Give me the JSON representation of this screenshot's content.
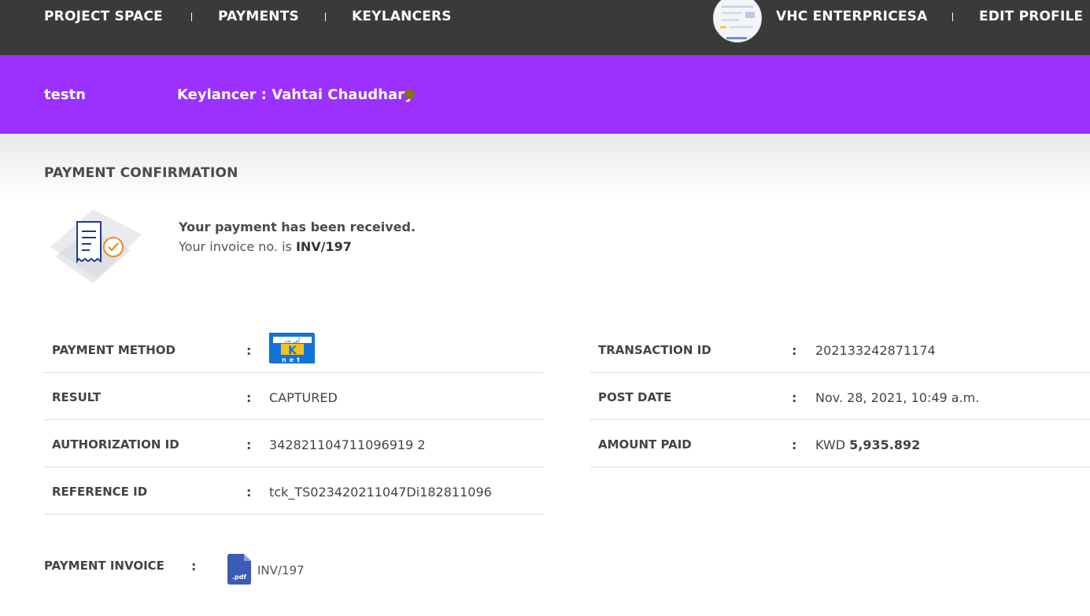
{
  "nav": {
    "project_space": "PROJECT SPACE",
    "payments": "PAYMENTS",
    "keylancers": "KEYLANCERS",
    "company": "VHC ENTERPRICESA",
    "edit_profile": "EDIT PROFILE"
  },
  "banner": {
    "project": "testn",
    "keylancer_label": "Keylancer : Vahtai Chaudhary"
  },
  "page": {
    "title": "PAYMENT CONFIRMATION",
    "received_msg": "Your payment has been received.",
    "invoice_prefix": "Your invoice no. is",
    "invoice_no": "INV/197"
  },
  "left_table": [
    {
      "label": "PAYMENT METHOD",
      "colon": ":",
      "value": ""
    },
    {
      "label": "RESULT",
      "colon": ":",
      "value": "CAPTURED"
    },
    {
      "label": "AUTHORIZATION ID",
      "colon": ":",
      "value": "342821104711096919 2"
    },
    {
      "label": "REFERENCE ID",
      "colon": ":",
      "value": "tck_TS023420211047Di182811096"
    }
  ],
  "right_table": [
    {
      "label": "TRANSACTION ID",
      "colon": ":",
      "value": "202133242871174"
    },
    {
      "label": "POST DATE",
      "colon": ":",
      "value": "Nov. 28, 2021, 10:49 a.m."
    },
    {
      "label": "AMOUNT PAID",
      "colon": ":",
      "currency": "KWD",
      "amount": "5,935.892"
    }
  ],
  "payment_method_logo": {
    "top": "كي نت",
    "letter": "K",
    "bottom": "net",
    "color": "#1473d8"
  },
  "invoice": {
    "label": "PAYMENT INVOICE",
    "colon": ":",
    "pdf_text": ".pdf",
    "link": "INV/197"
  },
  "colors": {
    "topbar": "#3a3a3a",
    "banner": "#9b30ff",
    "status_dot": "#8a6d14",
    "accent_icon": "#f08a24",
    "icon_blue": "#1e3a8a"
  }
}
